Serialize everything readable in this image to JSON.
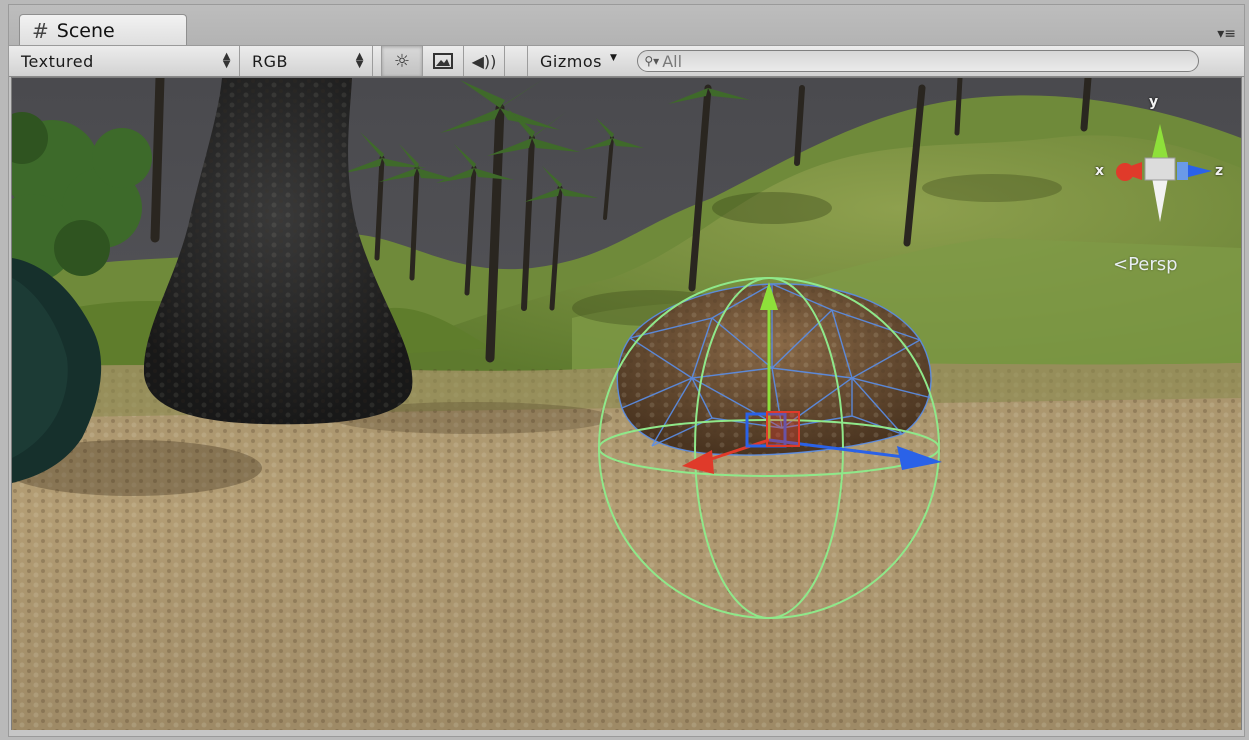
{
  "tab": {
    "title": "Scene",
    "icon": "grid-hash-icon"
  },
  "toolbar": {
    "render_mode": "Textured",
    "color_mode": "RGB",
    "lighting_icon": "sun-icon",
    "image_effects_icon": "image-icon",
    "audio_icon": "speaker-icon",
    "gizmos_label": "Gizmos",
    "search_placeholder": "All"
  },
  "orientation_gizmo": {
    "x_label": "x",
    "y_label": "y",
    "z_label": "z",
    "projection_label": "Persp"
  },
  "colors": {
    "x_axis": "#e03a2a",
    "y_axis": "#8ee03a",
    "z_axis": "#2a62e8",
    "collider": "#8fe88a",
    "wireframe": "#5a8ee8"
  }
}
